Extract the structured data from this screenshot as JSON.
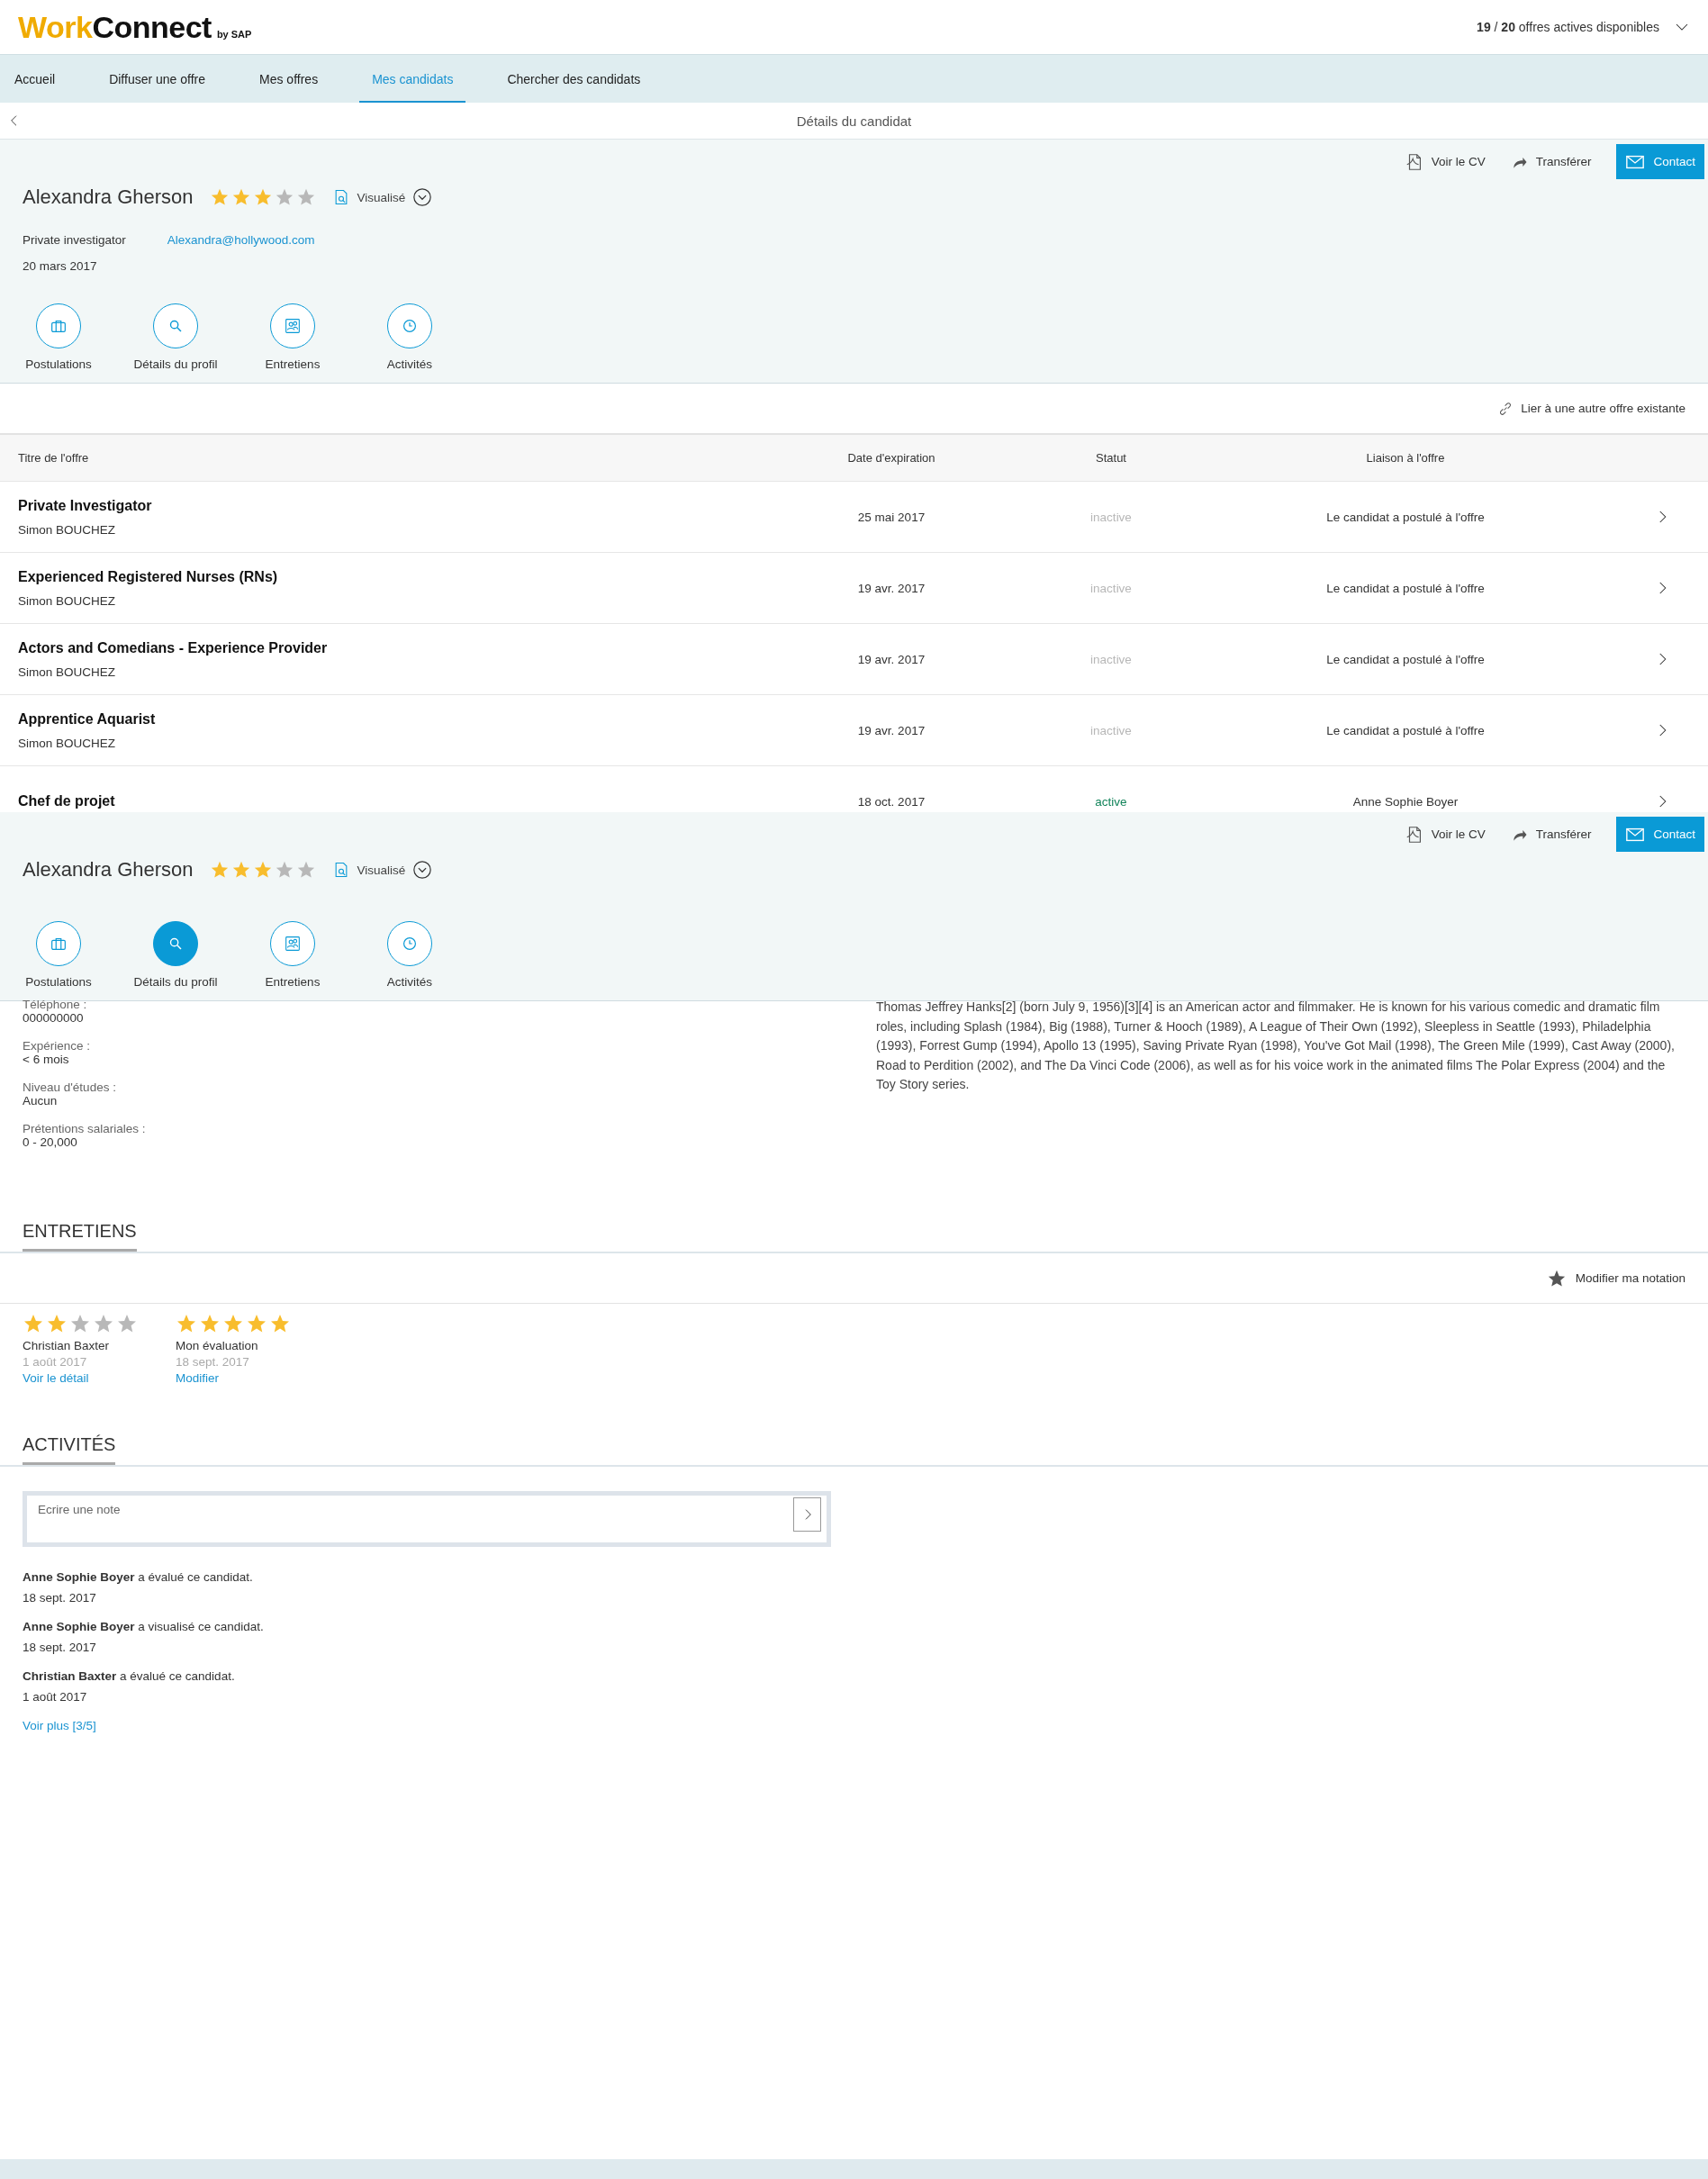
{
  "header": {
    "logo": {
      "part_1": "Work",
      "part_2": "Connect",
      "suffix": "by SAP"
    },
    "offers_count": "**19** / **20** offres actives disponibles"
  },
  "nav": {
    "tabs": [
      {
        "label": "Accueil",
        "selected": false
      },
      {
        "label": "Diffuser une offre",
        "selected": false
      },
      {
        "label": "Mes offres",
        "selected": false
      },
      {
        "label": "Mes candidats",
        "selected": true
      },
      {
        "label": "Chercher des candidats",
        "selected": false
      }
    ]
  },
  "subheader": {
    "title": "Détails du candidat"
  },
  "candidate_panels": [
    {
      "name": "Alexandra Gherson",
      "stars": 3,
      "status": "Visualisé",
      "actions": [
        "Voir le CV",
        "Transférer",
        "Contact"
      ],
      "role": "Private investigator",
      "email": "Alexandra@hollywood.com",
      "date": "20 mars 2017",
      "sections": [
        {
          "label": "Postulations",
          "selected": false
        },
        {
          "label": "Détails du profil",
          "selected": false
        },
        {
          "label": "Entretiens",
          "selected": false
        },
        {
          "label": "Activités",
          "selected": false
        }
      ]
    },
    {
      "name": "Alexandra Gherson",
      "stars": 3,
      "status": "Visualisé",
      "actions": [
        "Voir le CV",
        "Transférer",
        "Contact"
      ],
      "sections": [
        {
          "label": "Postulations",
          "selected": false
        },
        {
          "label": "Détails du profil",
          "selected": true
        },
        {
          "label": "Entretiens",
          "selected": false
        },
        {
          "label": "Activités",
          "selected": false
        }
      ]
    }
  ],
  "link_action": "Lier à une autre offre existante",
  "offers_table": {
    "columns": [
      "Titre de l'offre",
      "Date d'expiration",
      "Statut",
      "Liaison à l'offre"
    ],
    "rows": [
      {
        "title": "Private Investigator",
        "recruiter": "Simon BOUCHEZ",
        "date": "25 mai 2017",
        "status": "inactive",
        "active": false,
        "link": "Le candidat a postulé à l'offre"
      },
      {
        "title": "Experienced Registered Nurses (RNs)",
        "recruiter": "Simon BOUCHEZ",
        "date": "19 avr. 2017",
        "status": "inactive",
        "active": false,
        "link": "Le candidat a postulé à l'offre"
      },
      {
        "title": "Actors and Comedians - Experience Provider",
        "recruiter": "Simon BOUCHEZ",
        "date": "19 avr. 2017",
        "status": "inactive",
        "active": false,
        "link": "Le candidat a postulé à l'offre"
      },
      {
        "title": "Apprentice Aquarist",
        "recruiter": "Simon BOUCHEZ",
        "date": "19 avr. 2017",
        "status": "inactive",
        "active": false,
        "link": "Le candidat a postulé à l'offre"
      },
      {
        "title": "Chef de projet",
        "date": "18 oct. 2017",
        "status": "active",
        "active": true,
        "link": "Anne Sophie Boyer"
      }
    ]
  },
  "profile": {
    "fields": [
      {
        "label": "Téléphone :",
        "value": "000000000"
      },
      {
        "label": "Expérience :",
        "value": "< 6 mois"
      },
      {
        "label": "Niveau d'études :",
        "value": "Aucun"
      },
      {
        "label": "Prétentions salariales :",
        "value": "0 - 20,000"
      }
    ],
    "bio": "Thomas Jeffrey Hanks[2] (born July 9, 1956)[3][4] is an American actor and filmmaker. He is known for his various comedic and dramatic film roles, including Splash (1984), Big (1988), Turner & Hooch (1989), A League of Their Own (1992), Sleepless in Seattle (1993), Philadelphia (1993), Forrest Gump (1994), Apollo 13 (1995), Saving Private Ryan (1998), You've Got Mail (1998), The Green Mile (1999), Cast Away (2000), Road to Perdition (2002), and The Da Vinci Code (2006), as well as for his voice work in the animated films The Polar Express (2004) and the Toy Story series."
  },
  "interviews": {
    "title": "ENTRETIENS",
    "rate_action": "Modifier ma notation",
    "ratings": [
      {
        "stars": 2,
        "name": "Christian Baxter",
        "date": "1 août 2017",
        "link": "Voir le détail"
      },
      {
        "stars": 5,
        "name": "Mon évaluation",
        "date": "18 sept. 2017",
        "link": "Modifier"
      }
    ]
  },
  "activities": {
    "title": "ACTIVITÉS",
    "note_placeholder": "Ecrire une note",
    "items": [
      {
        "text": "**Anne Sophie Boyer** a évalué ce candidat.",
        "date": "18 sept. 2017"
      },
      {
        "text": "**Anne Sophie Boyer** a visualisé ce candidat.",
        "date": "18 sept. 2017"
      },
      {
        "text": "**Christian Baxter** a évalué ce candidat.",
        "date": "1 août 2017"
      }
    ],
    "more_link": "Voir plus [3/5]"
  }
}
